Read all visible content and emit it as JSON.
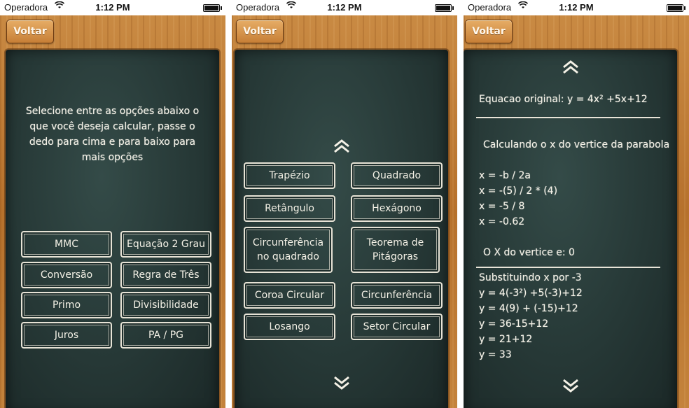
{
  "status": {
    "carrier": "Operadora",
    "time": "1:12 PM"
  },
  "back_label": "Voltar",
  "screen1": {
    "intro": "Selecione entre as opções abaixo o que você deseja calcular, passe o dedo para cima e para baixo para mais opções",
    "options": [
      "MMC",
      "Equação 2 Grau",
      "Conversão",
      "Regra de Três",
      "Primo",
      "Divisibilidade",
      "Juros",
      "PA / PG"
    ]
  },
  "screen2": {
    "options": [
      "Trapézio",
      "Quadrado",
      "Retângulo",
      "Hexágono",
      "Circunferência no quadrado",
      "Teorema de Pitágoras",
      "Coroa Circular",
      "Circunferência",
      "Losango",
      "Setor Circular"
    ]
  },
  "screen3": {
    "original": "Equacao original: y = 4x² +5x+12",
    "heading": "Calculando o x do vertice da parabola",
    "steps": [
      "x = -b / 2a",
      "x = -(5) / 2 * (4)",
      "x = -5 / 8",
      "x = -0.62"
    ],
    "vertex": "O X do vertice e: 0",
    "subst_title": "Substituindo x por -3",
    "subst": [
      "y = 4(-3²) +5(-3)+12",
      "y = 4(9) + (-15)+12",
      "y = 36-15+12",
      "y = 21+12",
      "y = 33"
    ]
  },
  "colors": {
    "board": "#263836",
    "chalk": "#f4f1e6",
    "wood": "#c07a35"
  },
  "icons": [
    "wifi-icon",
    "battery-icon",
    "chevron-up-icon",
    "chevron-down-icon"
  ]
}
